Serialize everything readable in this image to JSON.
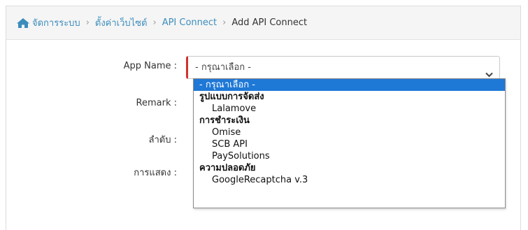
{
  "breadcrumb": {
    "items": [
      {
        "label": "จัดการระบบ"
      },
      {
        "label": "ตั้งค่าเว็บไซต์"
      },
      {
        "label": "API Connect"
      },
      {
        "label": "Add API Connect"
      }
    ]
  },
  "form": {
    "app_name_label": "App Name :",
    "remark_label": "Remark :",
    "order_label": "ลำดับ :",
    "display_label": "การแสดง :",
    "app_name_value": "- กรุณาเลือก -"
  },
  "dropdown": {
    "options": [
      {
        "label": "- กรุณาเลือก -",
        "kind": "option",
        "selected": true
      },
      {
        "label": "รูปแบบการจัดส่ง",
        "kind": "group"
      },
      {
        "label": "Lalamove",
        "kind": "child"
      },
      {
        "label": "การชำระเงิน",
        "kind": "group"
      },
      {
        "label": "Omise",
        "kind": "child"
      },
      {
        "label": "SCB API",
        "kind": "child"
      },
      {
        "label": "PaySolutions",
        "kind": "child"
      },
      {
        "label": "ความปลอดภัย",
        "kind": "group"
      },
      {
        "label": "GoogleRecaptcha v.3",
        "kind": "child"
      }
    ]
  },
  "colors": {
    "accent_link": "#3c8dbc",
    "required_border": "#d2322d",
    "selected_option": "#1e78d6"
  },
  "icons": {
    "home": "home-icon",
    "select_arrow": "chevron-down-icon"
  }
}
